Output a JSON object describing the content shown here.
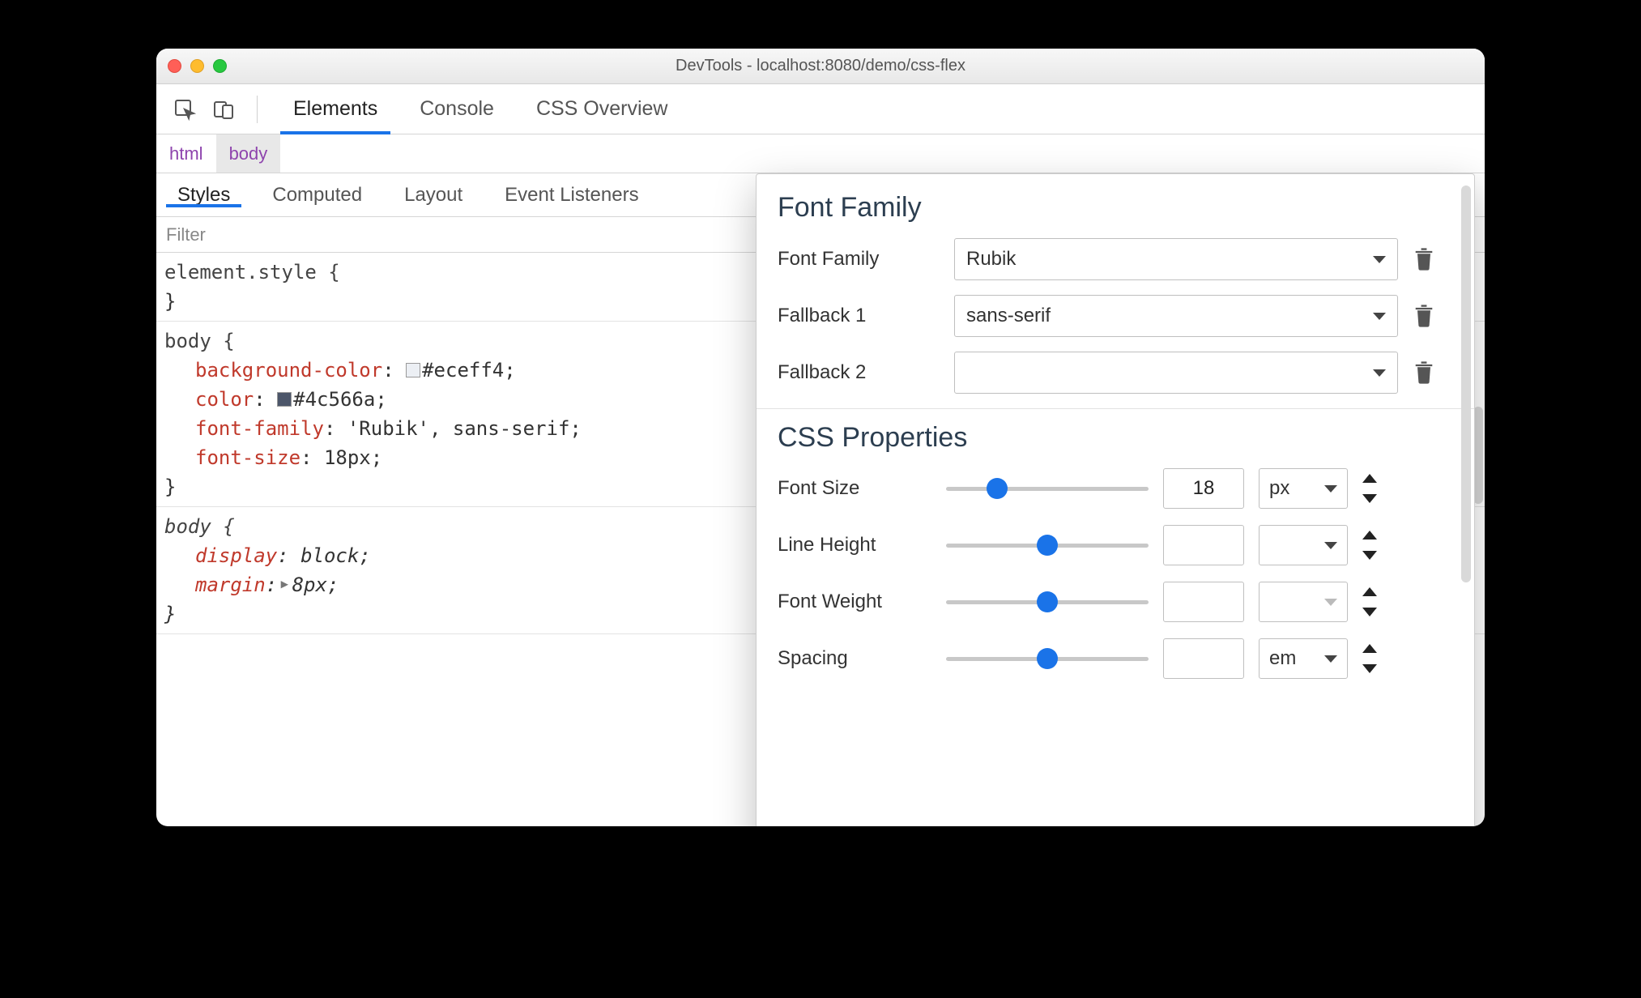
{
  "window": {
    "title": "DevTools - localhost:8080/demo/css-flex"
  },
  "toolbar": {
    "tabs": [
      "Elements",
      "Console",
      "CSS Overview"
    ],
    "active_tab": 0
  },
  "breadcrumb": {
    "items": [
      "html",
      "body"
    ],
    "selected_index": 1
  },
  "subtabs": {
    "items": [
      "Styles",
      "Computed",
      "Layout",
      "Event Listeners"
    ],
    "active_index": 0
  },
  "filter": {
    "placeholder": "Filter",
    "value": ""
  },
  "rules": [
    {
      "selector": "element.style",
      "italic": false,
      "declarations": []
    },
    {
      "selector": "body",
      "italic": false,
      "declarations": [
        {
          "prop": "background-color",
          "value": "#eceff4",
          "swatch": "#eceff4"
        },
        {
          "prop": "color",
          "value": "#4c566a",
          "swatch": "#4c566a"
        },
        {
          "prop": "font-family",
          "value": "'Rubik', sans-serif"
        },
        {
          "prop": "font-size",
          "value": "18px"
        }
      ]
    },
    {
      "selector": "body",
      "italic": true,
      "declarations": [
        {
          "prop": "display",
          "value": "block",
          "italic": true
        },
        {
          "prop": "margin",
          "value": "8px",
          "italic": true,
          "expander": true
        }
      ]
    }
  ],
  "font_editor": {
    "sections": {
      "family": {
        "title": "Font Family",
        "rows": [
          {
            "label": "Font Family",
            "value": "Rubik"
          },
          {
            "label": "Fallback 1",
            "value": "sans-serif"
          },
          {
            "label": "Fallback 2",
            "value": ""
          }
        ]
      },
      "properties": {
        "title": "CSS Properties",
        "rows": [
          {
            "label": "Font Size",
            "thumb_pct": 25,
            "value": "18",
            "unit": "px",
            "unit_enabled": true
          },
          {
            "label": "Line Height",
            "thumb_pct": 50,
            "value": "",
            "unit": "",
            "unit_enabled": true
          },
          {
            "label": "Font Weight",
            "thumb_pct": 50,
            "value": "",
            "unit": "",
            "unit_enabled": false
          },
          {
            "label": "Spacing",
            "thumb_pct": 50,
            "value": "",
            "unit": "em",
            "unit_enabled": true
          }
        ]
      }
    }
  }
}
